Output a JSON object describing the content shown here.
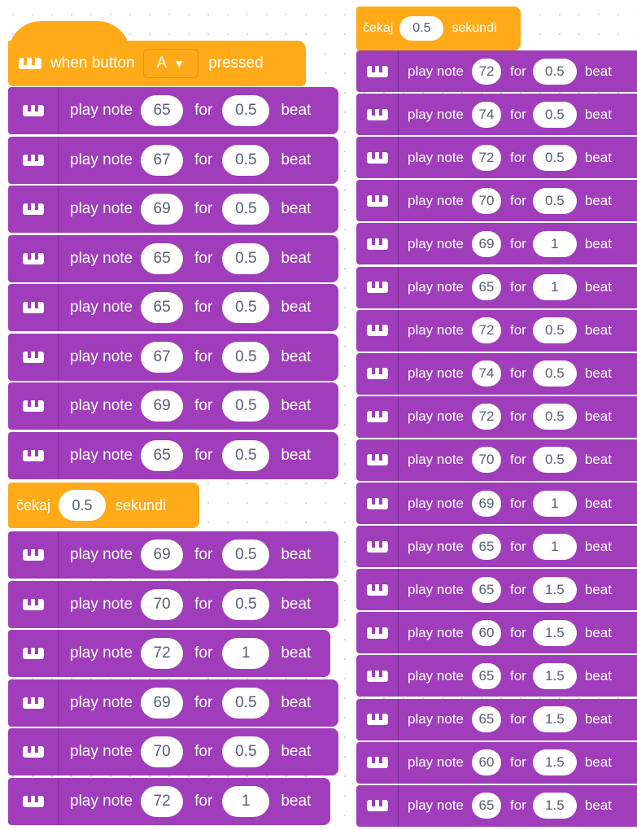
{
  "colors": {
    "motion_purple": "#9F3DBB",
    "event_orange": "#FFAB19"
  },
  "left_script": {
    "hat": {
      "prefix": "when button",
      "button": "A",
      "caret": "▼",
      "suffix": "pressed"
    },
    "blocks_a": [
      {
        "label": "play note",
        "note": "65",
        "for": "for",
        "beats": "0.5",
        "unit": "beat"
      },
      {
        "label": "play note",
        "note": "67",
        "for": "for",
        "beats": "0.5",
        "unit": "beat"
      },
      {
        "label": "play note",
        "note": "69",
        "for": "for",
        "beats": "0.5",
        "unit": "beat"
      },
      {
        "label": "play note",
        "note": "65",
        "for": "for",
        "beats": "0.5",
        "unit": "beat"
      },
      {
        "label": "play note",
        "note": "65",
        "for": "for",
        "beats": "0.5",
        "unit": "beat"
      },
      {
        "label": "play note",
        "note": "67",
        "for": "for",
        "beats": "0.5",
        "unit": "beat"
      },
      {
        "label": "play note",
        "note": "69",
        "for": "for",
        "beats": "0.5",
        "unit": "beat"
      },
      {
        "label": "play note",
        "note": "65",
        "for": "for",
        "beats": "0.5",
        "unit": "beat"
      }
    ],
    "wait": {
      "label": "čekaj",
      "value": "0.5",
      "unit": "sekundi"
    },
    "blocks_b": [
      {
        "label": "play note",
        "note": "69",
        "for": "for",
        "beats": "0.5",
        "unit": "beat"
      },
      {
        "label": "play note",
        "note": "70",
        "for": "for",
        "beats": "0.5",
        "unit": "beat"
      },
      {
        "label": "play note",
        "note": "72",
        "for": "for",
        "beats": "1",
        "unit": "beat"
      },
      {
        "label": "play note",
        "note": "69",
        "for": "for",
        "beats": "0.5",
        "unit": "beat"
      },
      {
        "label": "play note",
        "note": "70",
        "for": "for",
        "beats": "0.5",
        "unit": "beat"
      },
      {
        "label": "play note",
        "note": "72",
        "for": "for",
        "beats": "1",
        "unit": "beat"
      }
    ]
  },
  "right_script": {
    "wait": {
      "label": "čekaj",
      "value": "0.5",
      "unit": "sekundi"
    },
    "blocks": [
      {
        "label": "play note",
        "note": "72",
        "for": "for",
        "beats": "0.5",
        "unit": "beat"
      },
      {
        "label": "play note",
        "note": "74",
        "for": "for",
        "beats": "0.5",
        "unit": "beat"
      },
      {
        "label": "play note",
        "note": "72",
        "for": "for",
        "beats": "0.5",
        "unit": "beat"
      },
      {
        "label": "play note",
        "note": "70",
        "for": "for",
        "beats": "0.5",
        "unit": "beat"
      },
      {
        "label": "play note",
        "note": "69",
        "for": "for",
        "beats": "1",
        "unit": "beat"
      },
      {
        "label": "play note",
        "note": "65",
        "for": "for",
        "beats": "1",
        "unit": "beat"
      },
      {
        "label": "play note",
        "note": "72",
        "for": "for",
        "beats": "0.5",
        "unit": "beat"
      },
      {
        "label": "play note",
        "note": "74",
        "for": "for",
        "beats": "0.5",
        "unit": "beat"
      },
      {
        "label": "play note",
        "note": "72",
        "for": "for",
        "beats": "0.5",
        "unit": "beat"
      },
      {
        "label": "play note",
        "note": "70",
        "for": "for",
        "beats": "0.5",
        "unit": "beat"
      },
      {
        "label": "play note",
        "note": "69",
        "for": "for",
        "beats": "1",
        "unit": "beat"
      },
      {
        "label": "play note",
        "note": "65",
        "for": "for",
        "beats": "1",
        "unit": "beat"
      },
      {
        "label": "play note",
        "note": "65",
        "for": "for",
        "beats": "1.5",
        "unit": "beat"
      },
      {
        "label": "play note",
        "note": "60",
        "for": "for",
        "beats": "1.5",
        "unit": "beat"
      },
      {
        "label": "play note",
        "note": "65",
        "for": "for",
        "beats": "1.5",
        "unit": "beat"
      },
      {
        "label": "play note",
        "note": "65",
        "for": "for",
        "beats": "1.5",
        "unit": "beat"
      },
      {
        "label": "play note",
        "note": "60",
        "for": "for",
        "beats": "1.5",
        "unit": "beat"
      },
      {
        "label": "play note",
        "note": "65",
        "for": "for",
        "beats": "1.5",
        "unit": "beat"
      }
    ]
  }
}
